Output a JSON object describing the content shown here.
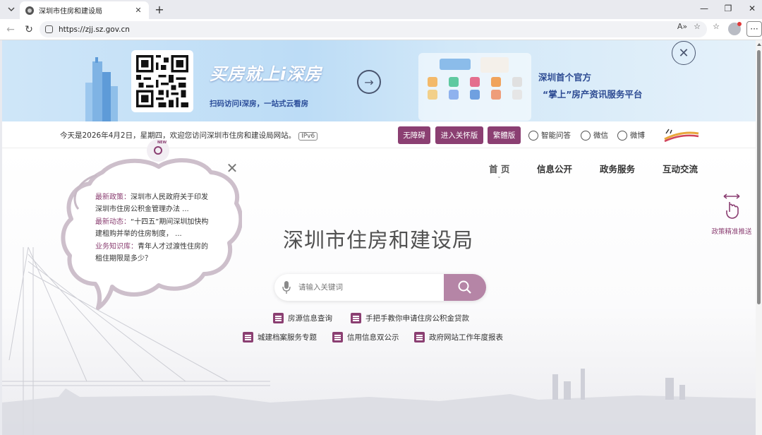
{
  "browser": {
    "tab_title": "深圳市住房和建设局",
    "url": "https://zjj.sz.gov.cn",
    "tab_close": "✕",
    "new_tab": "+",
    "min": "—",
    "restore": "❐",
    "close": "✕",
    "back": "←",
    "refresh": "↻",
    "read_aloud": "A»",
    "favorite": "☆",
    "collections": "☆",
    "more": "···"
  },
  "banner": {
    "slogan_line1": "买房就上i深房",
    "slogan_line2": "扫码访问i深房，一站式云看房",
    "promo_line1": "深圳首个官方",
    "promo_line2": "“掌上”房产资讯服务平台",
    "arrow": "→",
    "close": "✕"
  },
  "infobar": {
    "date_text": "今天是2026年4月2日，星期四，欢迎您访问深圳市住房和建设局网站。",
    "ipv6": "IPv6",
    "btn_accessible": "无障碍",
    "btn_elderly": "进入关怀版",
    "btn_traditional": "繁體版",
    "smart_qa": "智能问答",
    "wechat": "微信",
    "weibo": "微博"
  },
  "bubble": {
    "new_label": "NEW",
    "close": "✕",
    "items": [
      {
        "keyword": "最新政策：",
        "text": "深圳市人民政府关于印发深圳市住房公积金管理办法 ..."
      },
      {
        "keyword": "最新动态：",
        "text": "“十四五”期间深圳加快构建租购并举的住房制度，  ..."
      },
      {
        "keyword": "业务知识库：",
        "text": "青年人才过渡性住房的租住期限是多少？"
      }
    ]
  },
  "nav": {
    "items": [
      "首 页",
      "信息公开",
      "政务服务",
      "互动交流"
    ],
    "active_caret": "⌄"
  },
  "policy_push": "政策精准推送",
  "site_title": "深圳市住房和建设局",
  "search": {
    "placeholder": "请输入关键词"
  },
  "quick_links": [
    "房源信息查询",
    "手把手教你申请住房公积金贷款",
    "城建档案服务专题",
    "信用信息双公示",
    "政府网站工作年度报表"
  ],
  "colors": {
    "brand": "#8b3f72",
    "search_button": "#b585a6",
    "promo_text": "#2c4a92"
  }
}
